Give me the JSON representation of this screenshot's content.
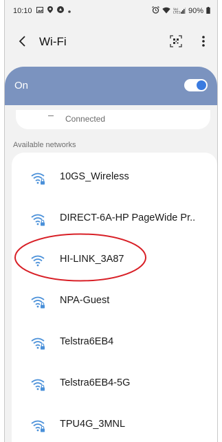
{
  "status_bar": {
    "time": "10:10",
    "battery": "90%"
  },
  "header": {
    "title": "Wi-Fi"
  },
  "master_switch": {
    "label": "On",
    "enabled": true
  },
  "current_network": {
    "status": "Connected"
  },
  "available": {
    "section_label": "Available networks",
    "networks": [
      {
        "ssid": "10GS_Wireless",
        "secured": true
      },
      {
        "ssid": "DIRECT-6A-HP PageWide Pr..",
        "secured": true
      },
      {
        "ssid": "HI-LINK_3A87",
        "secured": false
      },
      {
        "ssid": "NPA-Guest",
        "secured": true
      },
      {
        "ssid": "Telstra6EB4",
        "secured": true
      },
      {
        "ssid": "Telstra6EB4-5G",
        "secured": true
      },
      {
        "ssid": "TPU4G_3MNL",
        "secured": true
      }
    ]
  },
  "colors": {
    "accent_blue": "#3a7be0",
    "toggle_bar": "#7b93bf",
    "wifi_icon": "#4a90d9",
    "highlight_red": "#d81f26"
  },
  "icons": {
    "back": "back-arrow-icon",
    "qr": "qr-code-scan-icon",
    "more": "more-vertical-icon",
    "wifi": "wifi-signal-icon",
    "lock": "lock-icon"
  }
}
